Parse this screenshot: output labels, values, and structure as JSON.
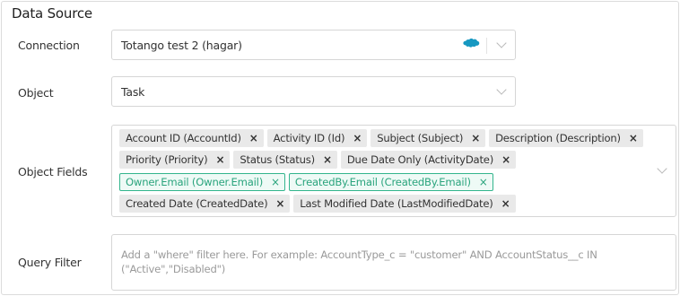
{
  "section": {
    "title": "Data Source"
  },
  "connection": {
    "label": "Connection",
    "value": "Totango test 2 (hagar)",
    "icon": "salesforce-cloud-icon",
    "icon_color": "#1798c1"
  },
  "object": {
    "label": "Object",
    "value": "Task"
  },
  "object_fields": {
    "label": "Object Fields",
    "tags": [
      {
        "label": "Account ID (AccountId)",
        "remove": "×"
      },
      {
        "label": "Activity ID (Id)",
        "remove": "×"
      },
      {
        "label": "Subject (Subject)",
        "remove": "×"
      },
      {
        "label": "Description (Description)",
        "remove": "×"
      },
      {
        "label": "Priority (Priority)",
        "remove": "×"
      },
      {
        "label": "Status (Status)",
        "remove": "×"
      },
      {
        "label": "Due Date Only (ActivityDate)",
        "remove": "×"
      },
      {
        "label": "Owner.Email (Owner.Email)",
        "remove": "×",
        "highlight": true
      },
      {
        "label": "CreatedBy.Email (CreatedBy.Email)",
        "remove": "×",
        "highlight": true
      },
      {
        "label": "Created Date (CreatedDate)",
        "remove": "×"
      },
      {
        "label": "Last Modified Date (LastModifiedDate)",
        "remove": "×"
      }
    ],
    "highlight_color": "#33b58d"
  },
  "query_filter": {
    "label": "Query Filter",
    "placeholder": "Add a \"where\" filter here. For example: AccountType_c = \"customer\" AND AccountStatus__c IN (\"Active\",\"Disabled\")"
  }
}
